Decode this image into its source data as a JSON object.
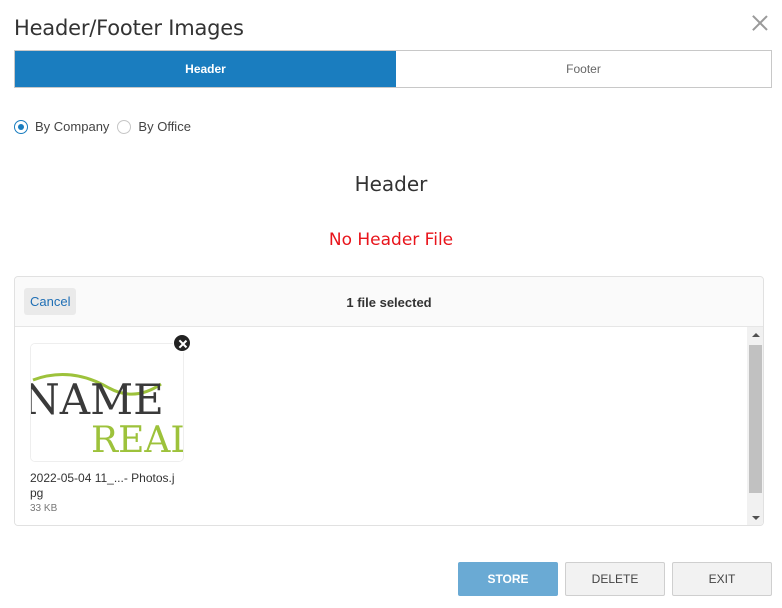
{
  "dialog": {
    "title": "Header/Footer Images"
  },
  "tabs": [
    {
      "label": "Header",
      "active": true
    },
    {
      "label": "Footer",
      "active": false
    }
  ],
  "scope": {
    "options": [
      {
        "label": "By Company",
        "checked": true
      },
      {
        "label": "By Office",
        "checked": false
      }
    ]
  },
  "section": {
    "heading": "Header",
    "status": "No Header File"
  },
  "uploader": {
    "cancel_label": "Cancel",
    "file_count": "1 file selected",
    "file": {
      "name": "2022-05-04 11_...- Photos.jpg",
      "size": "33 KB",
      "thumb_line1": "NAME",
      "thumb_line2": "REAL"
    }
  },
  "actions": {
    "store": "STORE",
    "delete": "DELETE",
    "exit": "EXIT"
  },
  "colors": {
    "accent": "#1a7dbf",
    "error": "#e8141b",
    "store_button": "#6aaad4",
    "logo_green": "#9dc23b"
  }
}
